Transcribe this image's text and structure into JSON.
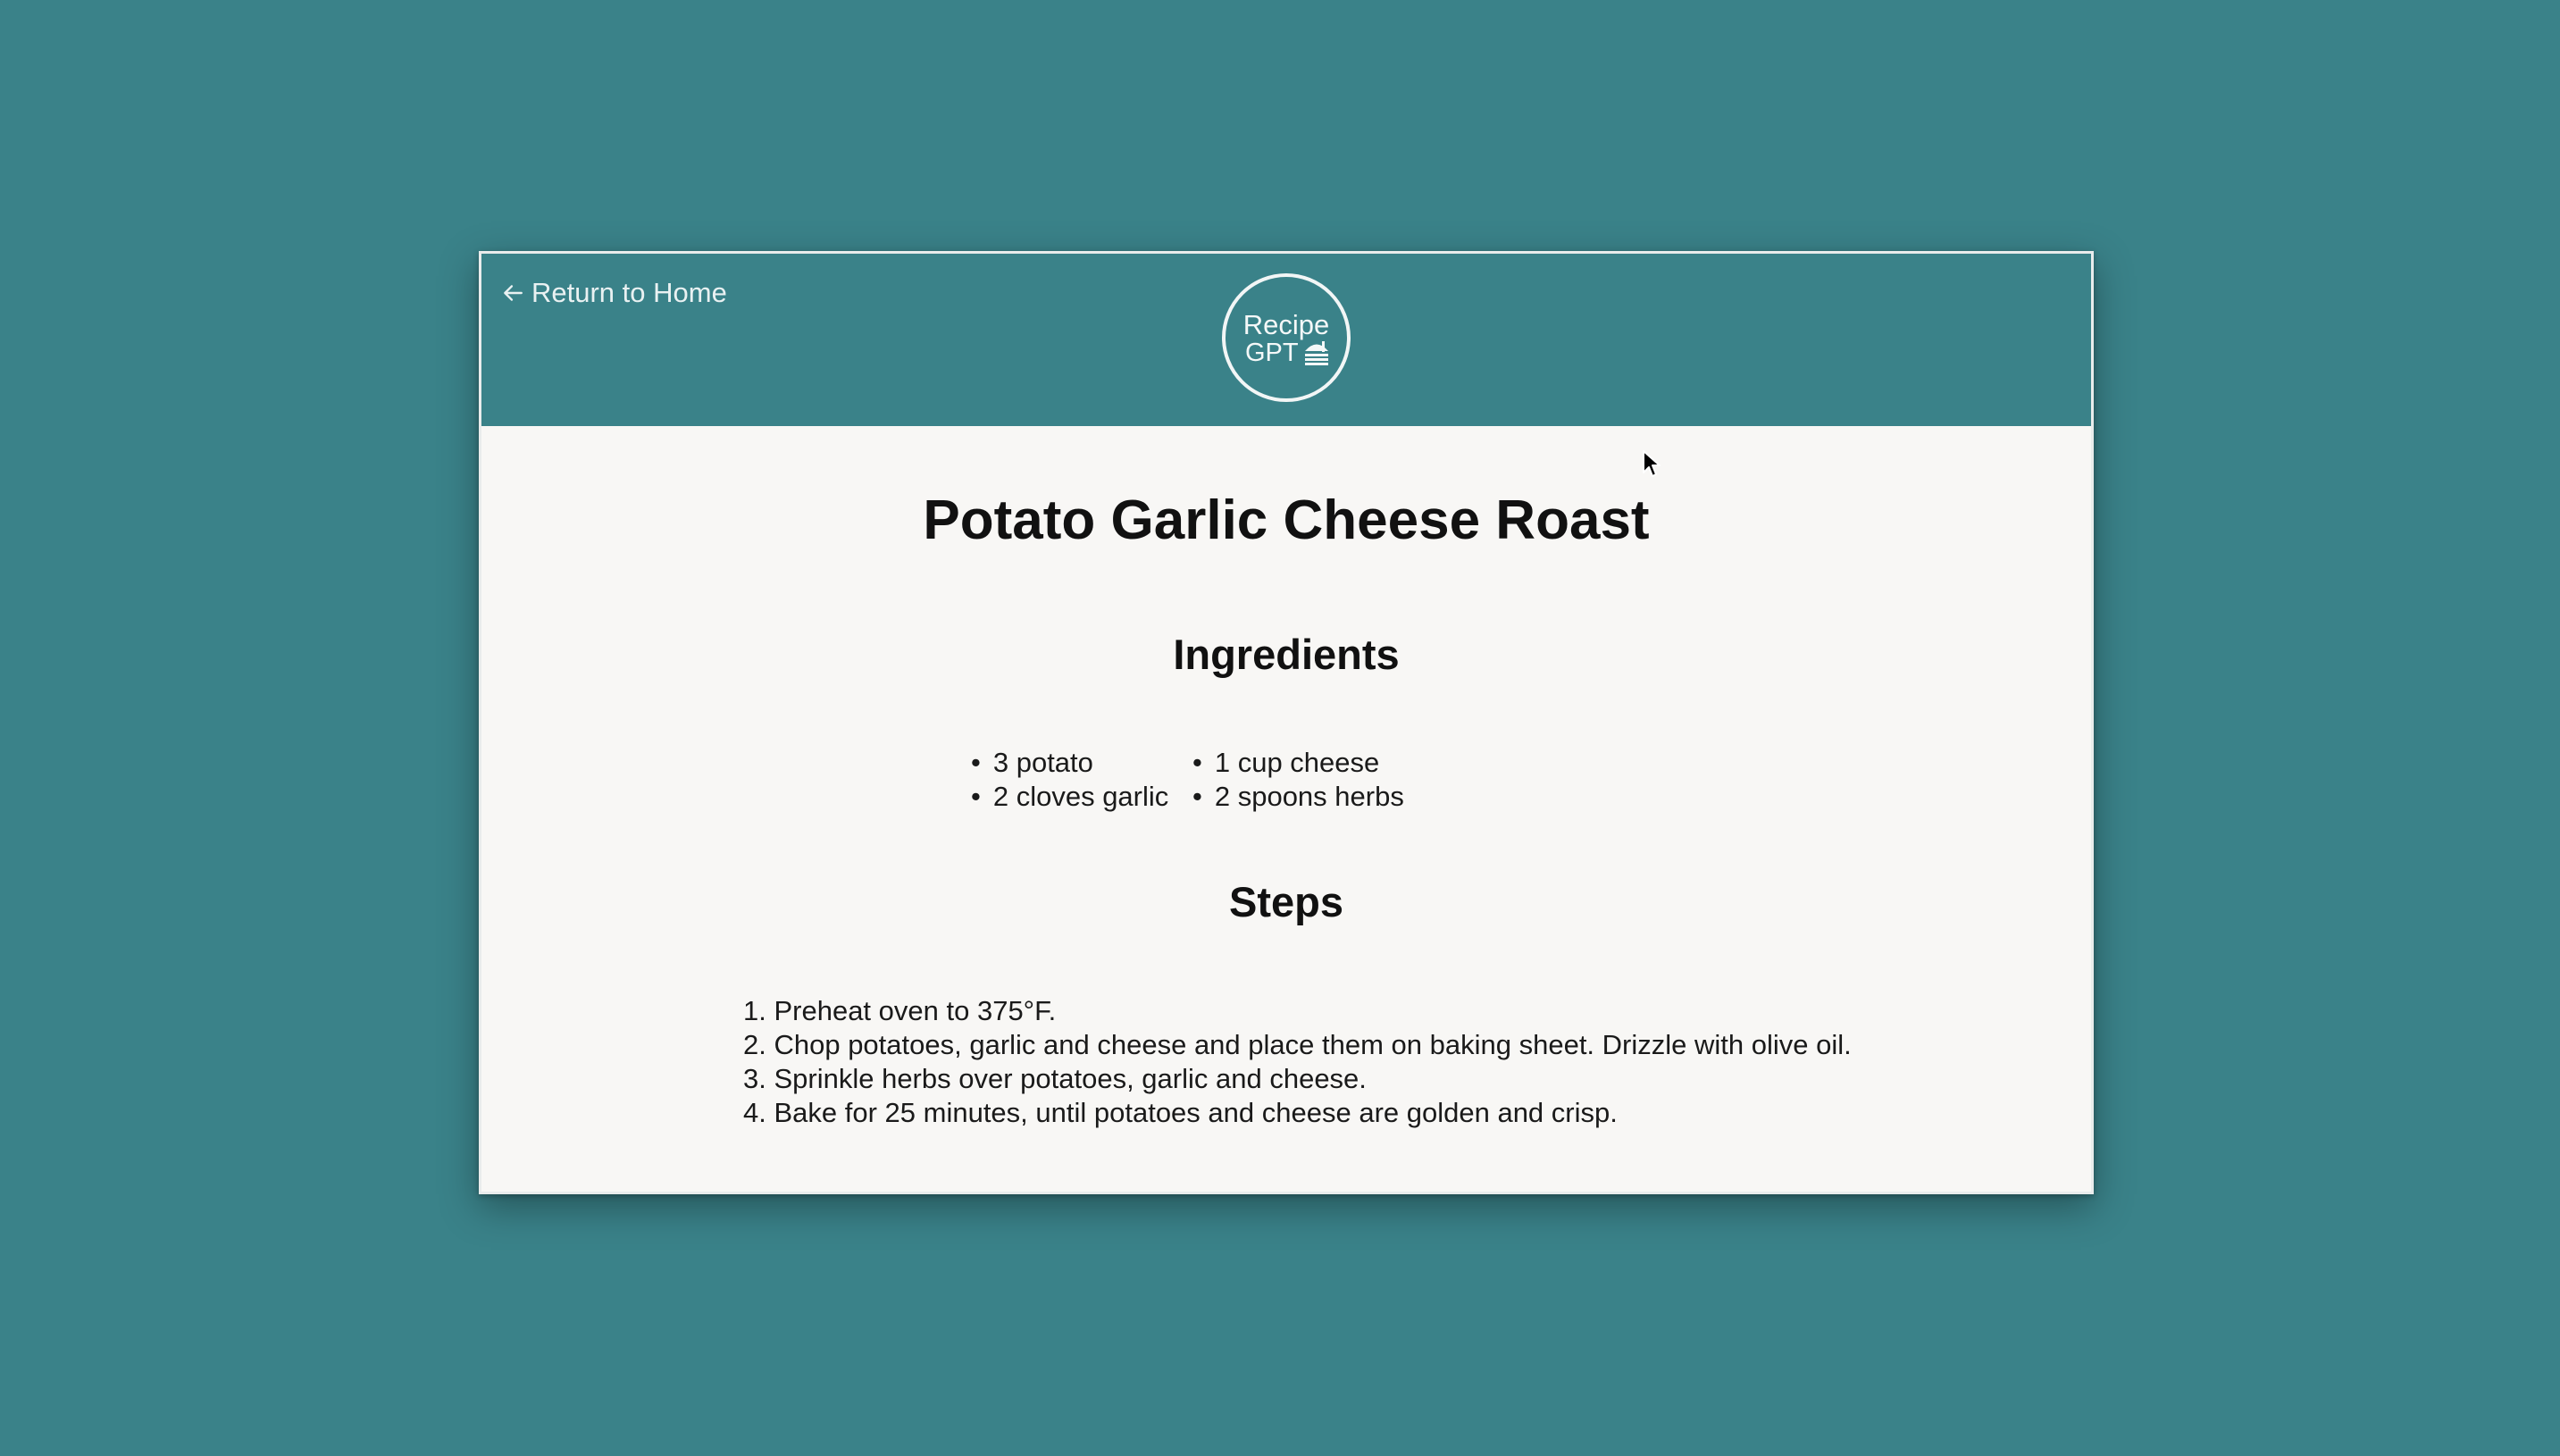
{
  "header": {
    "back_link_label": "Return to Home",
    "logo": {
      "line1": "Recipe",
      "line2": "GPT"
    }
  },
  "recipe": {
    "title": "Potato Garlic Cheese Roast",
    "ingredients_heading": "Ingredients",
    "ingredients": [
      "3 potato",
      "1 cup cheese",
      "2 cloves garlic",
      "2 spoons herbs"
    ],
    "steps_heading": "Steps",
    "steps": [
      "1. Preheat oven to 375°F.",
      "2. Chop potatoes, garlic and cheese and place them on baking sheet. Drizzle with olive oil.",
      "3. Sprinkle herbs over potatoes, garlic and cheese.",
      "4. Bake for 25 minutes, until potatoes and cheese are golden and crisp."
    ]
  },
  "icons": {
    "back": "left-arrow-icon",
    "logo_food": "burger-icon",
    "pointer": "mouse-cursor-icon"
  },
  "colors": {
    "background": "#3a8289",
    "header": "#3a8289",
    "content": "#f8f7f5",
    "text": "#111111",
    "header_text": "#f4f8f8"
  }
}
